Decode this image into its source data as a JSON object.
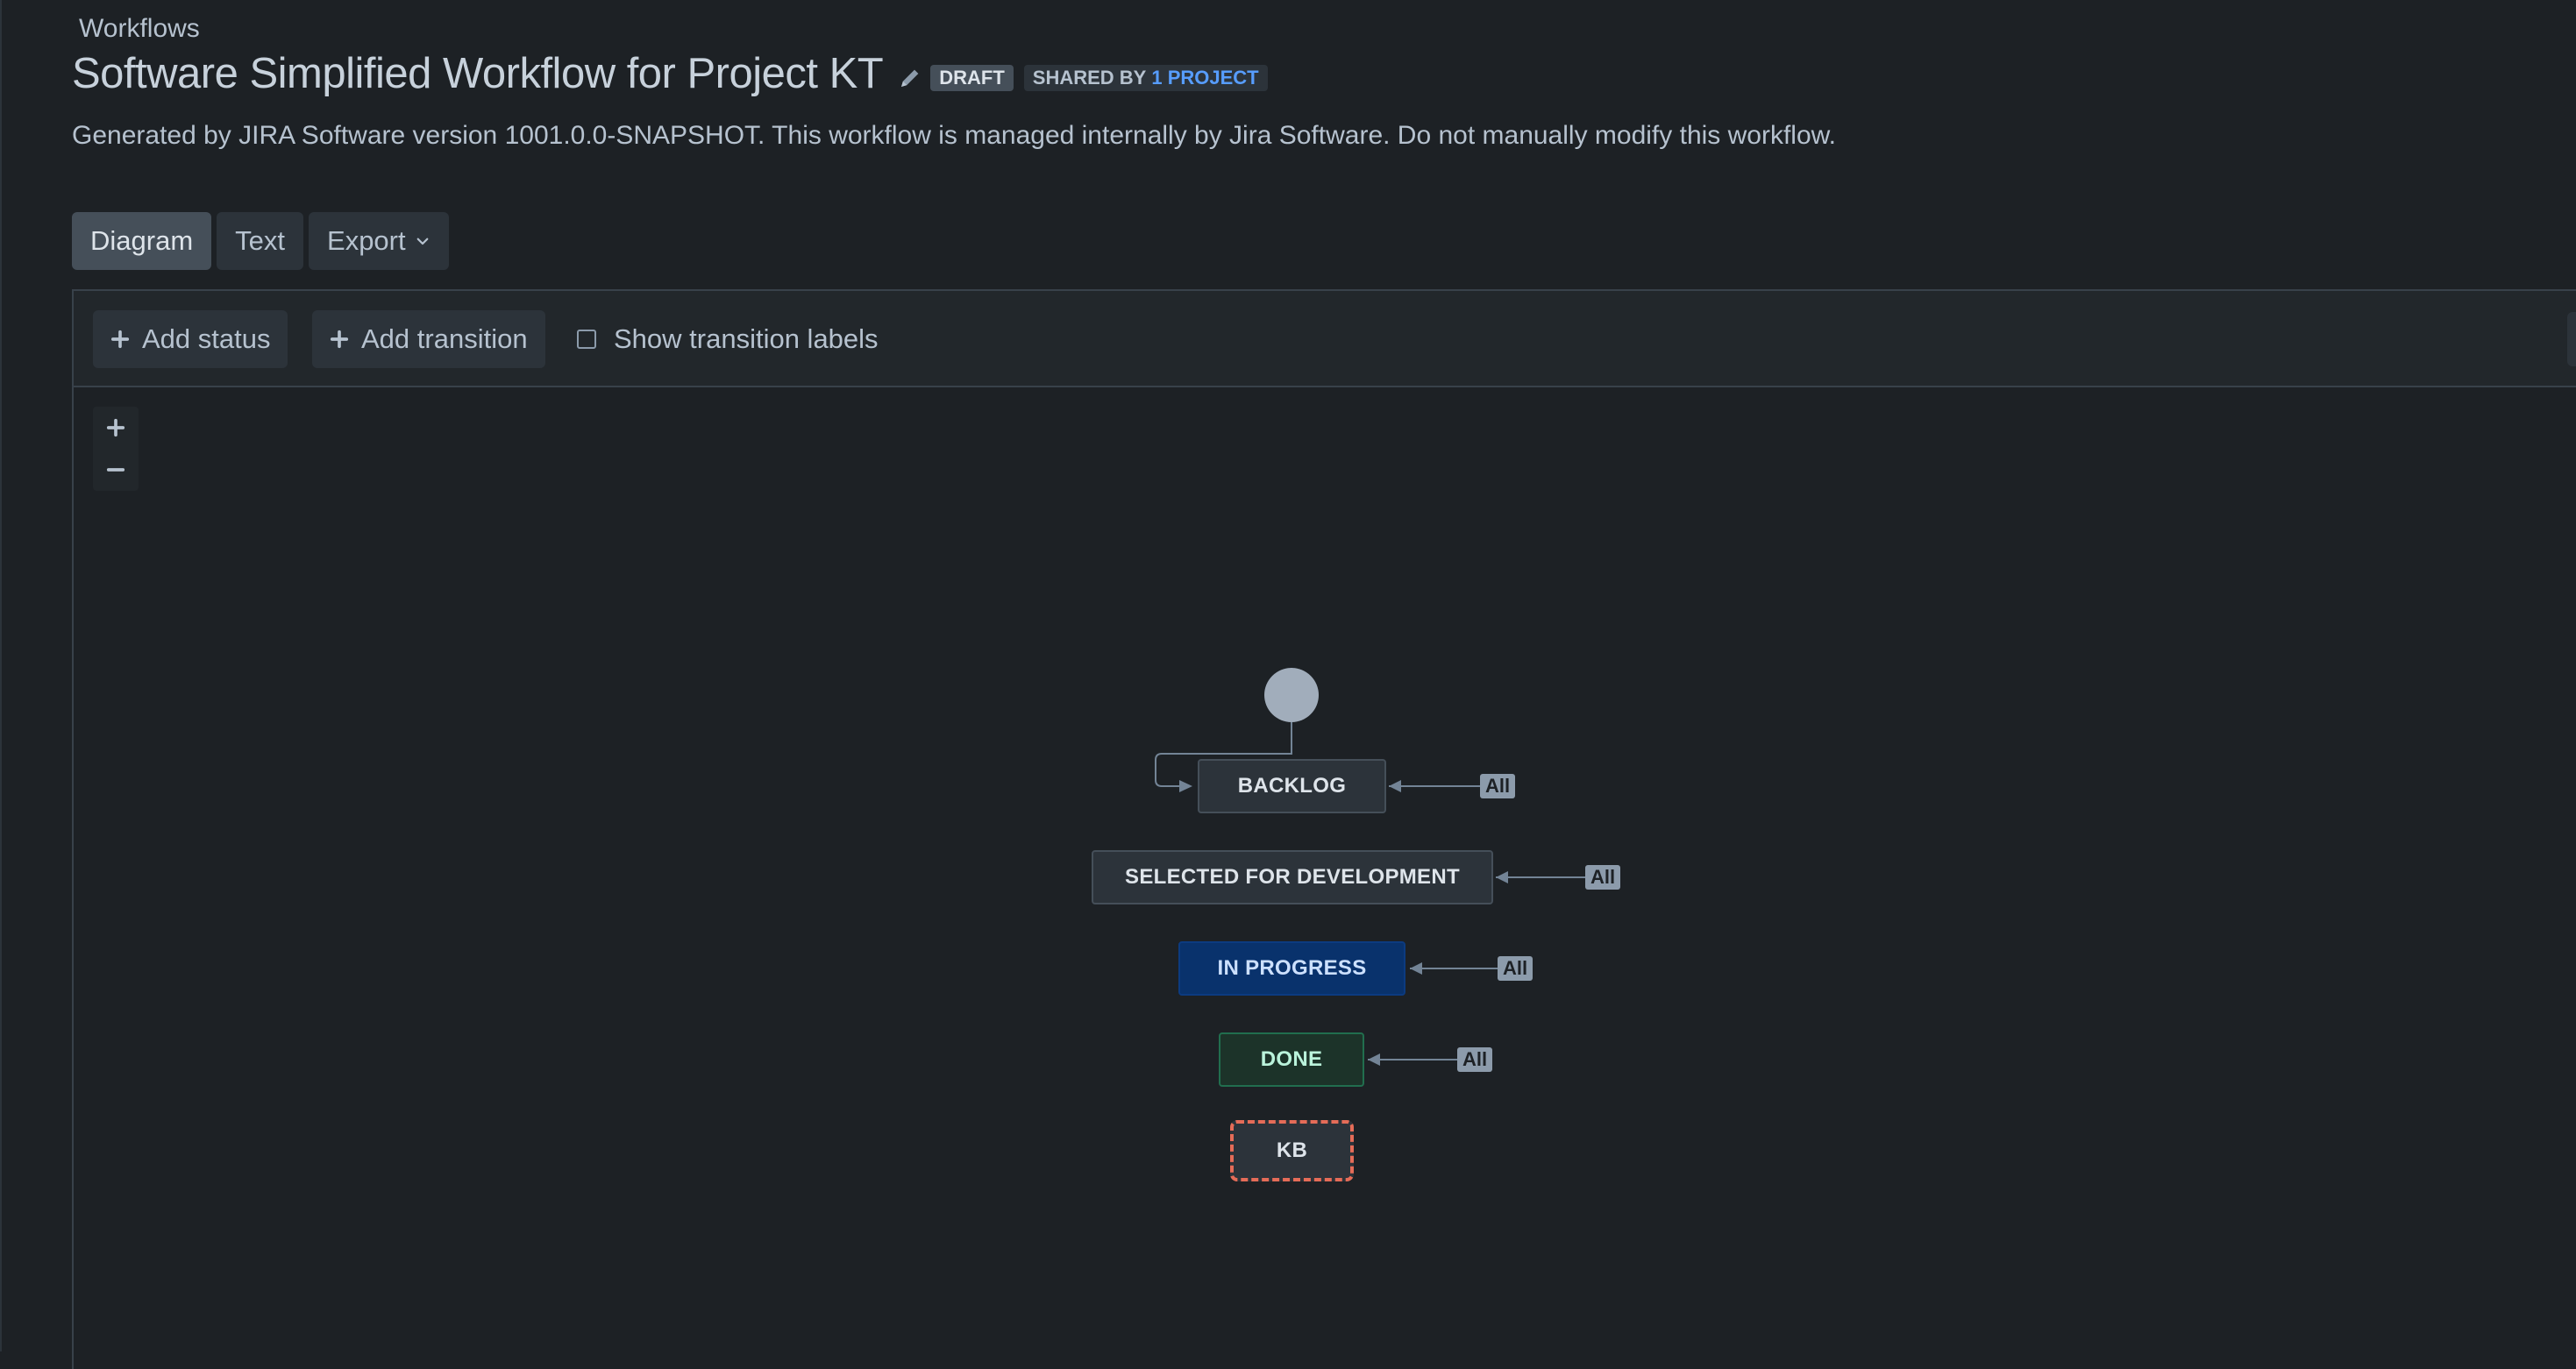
{
  "breadcrumb": "Workflows",
  "header": {
    "title": "Software Simplified Workflow for Project KT",
    "draft_badge": "DRAFT",
    "shared_prefix": "SHARED BY",
    "shared_link": "1 PROJECT",
    "description": "Generated by JIRA Software version 1001.0.0-SNAPSHOT. This workflow is managed internally by Jira Software. Do not manually modify this workflow."
  },
  "tabs": [
    {
      "label": "Diagram",
      "active": true
    },
    {
      "label": "Text",
      "active": false
    }
  ],
  "export_label": "Export",
  "toolbar": {
    "add_status": "Add status",
    "add_transition": "Add transition",
    "show_labels": "Show transition labels",
    "show_labels_checked": false
  },
  "zoom": {
    "in_icon": "plus-icon",
    "out_icon": "minus-icon"
  },
  "statuses": [
    {
      "label": "BACKLOG",
      "category": "todo",
      "global_transition": "All"
    },
    {
      "label": "SELECTED FOR DEVELOPMENT",
      "category": "todo",
      "global_transition": "All"
    },
    {
      "label": "IN PROGRESS",
      "category": "inprogress",
      "global_transition": "All"
    },
    {
      "label": "DONE",
      "category": "done",
      "global_transition": "All"
    },
    {
      "label": "KB",
      "category": "unsaved"
    }
  ],
  "colors": {
    "background": "#1d2125",
    "todo": "#2c333a",
    "in_progress": "#09326c",
    "done": "#1c3329",
    "kb_border": "#e56c58",
    "link": "#579dff",
    "all_badge": "#8c9bab"
  }
}
